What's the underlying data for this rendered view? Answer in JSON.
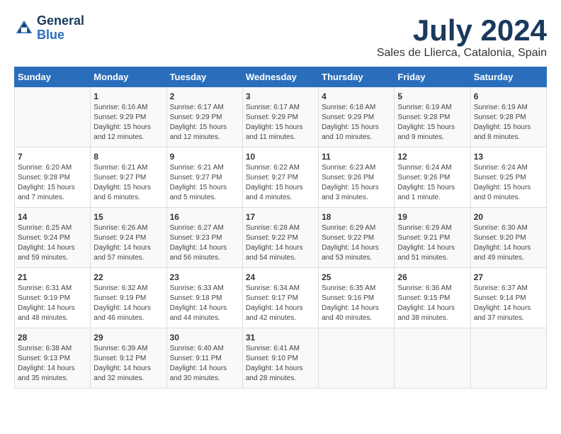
{
  "logo": {
    "line1": "General",
    "line2": "Blue"
  },
  "title": "July 2024",
  "location": "Sales de Llierca, Catalonia, Spain",
  "days_of_week": [
    "Sunday",
    "Monday",
    "Tuesday",
    "Wednesday",
    "Thursday",
    "Friday",
    "Saturday"
  ],
  "weeks": [
    [
      {
        "day": "",
        "sunrise": "",
        "sunset": "",
        "daylight": ""
      },
      {
        "day": "1",
        "sunrise": "Sunrise: 6:16 AM",
        "sunset": "Sunset: 9:29 PM",
        "daylight": "Daylight: 15 hours and 12 minutes."
      },
      {
        "day": "2",
        "sunrise": "Sunrise: 6:17 AM",
        "sunset": "Sunset: 9:29 PM",
        "daylight": "Daylight: 15 hours and 12 minutes."
      },
      {
        "day": "3",
        "sunrise": "Sunrise: 6:17 AM",
        "sunset": "Sunset: 9:29 PM",
        "daylight": "Daylight: 15 hours and 11 minutes."
      },
      {
        "day": "4",
        "sunrise": "Sunrise: 6:18 AM",
        "sunset": "Sunset: 9:29 PM",
        "daylight": "Daylight: 15 hours and 10 minutes."
      },
      {
        "day": "5",
        "sunrise": "Sunrise: 6:19 AM",
        "sunset": "Sunset: 9:28 PM",
        "daylight": "Daylight: 15 hours and 9 minutes."
      },
      {
        "day": "6",
        "sunrise": "Sunrise: 6:19 AM",
        "sunset": "Sunset: 9:28 PM",
        "daylight": "Daylight: 15 hours and 8 minutes."
      }
    ],
    [
      {
        "day": "7",
        "sunrise": "Sunrise: 6:20 AM",
        "sunset": "Sunset: 9:28 PM",
        "daylight": "Daylight: 15 hours and 7 minutes."
      },
      {
        "day": "8",
        "sunrise": "Sunrise: 6:21 AM",
        "sunset": "Sunset: 9:27 PM",
        "daylight": "Daylight: 15 hours and 6 minutes."
      },
      {
        "day": "9",
        "sunrise": "Sunrise: 6:21 AM",
        "sunset": "Sunset: 9:27 PM",
        "daylight": "Daylight: 15 hours and 5 minutes."
      },
      {
        "day": "10",
        "sunrise": "Sunrise: 6:22 AM",
        "sunset": "Sunset: 9:27 PM",
        "daylight": "Daylight: 15 hours and 4 minutes."
      },
      {
        "day": "11",
        "sunrise": "Sunrise: 6:23 AM",
        "sunset": "Sunset: 9:26 PM",
        "daylight": "Daylight: 15 hours and 3 minutes."
      },
      {
        "day": "12",
        "sunrise": "Sunrise: 6:24 AM",
        "sunset": "Sunset: 9:26 PM",
        "daylight": "Daylight: 15 hours and 1 minute."
      },
      {
        "day": "13",
        "sunrise": "Sunrise: 6:24 AM",
        "sunset": "Sunset: 9:25 PM",
        "daylight": "Daylight: 15 hours and 0 minutes."
      }
    ],
    [
      {
        "day": "14",
        "sunrise": "Sunrise: 6:25 AM",
        "sunset": "Sunset: 9:24 PM",
        "daylight": "Daylight: 14 hours and 59 minutes."
      },
      {
        "day": "15",
        "sunrise": "Sunrise: 6:26 AM",
        "sunset": "Sunset: 9:24 PM",
        "daylight": "Daylight: 14 hours and 57 minutes."
      },
      {
        "day": "16",
        "sunrise": "Sunrise: 6:27 AM",
        "sunset": "Sunset: 9:23 PM",
        "daylight": "Daylight: 14 hours and 56 minutes."
      },
      {
        "day": "17",
        "sunrise": "Sunrise: 6:28 AM",
        "sunset": "Sunset: 9:22 PM",
        "daylight": "Daylight: 14 hours and 54 minutes."
      },
      {
        "day": "18",
        "sunrise": "Sunrise: 6:29 AM",
        "sunset": "Sunset: 9:22 PM",
        "daylight": "Daylight: 14 hours and 53 minutes."
      },
      {
        "day": "19",
        "sunrise": "Sunrise: 6:29 AM",
        "sunset": "Sunset: 9:21 PM",
        "daylight": "Daylight: 14 hours and 51 minutes."
      },
      {
        "day": "20",
        "sunrise": "Sunrise: 6:30 AM",
        "sunset": "Sunset: 9:20 PM",
        "daylight": "Daylight: 14 hours and 49 minutes."
      }
    ],
    [
      {
        "day": "21",
        "sunrise": "Sunrise: 6:31 AM",
        "sunset": "Sunset: 9:19 PM",
        "daylight": "Daylight: 14 hours and 48 minutes."
      },
      {
        "day": "22",
        "sunrise": "Sunrise: 6:32 AM",
        "sunset": "Sunset: 9:19 PM",
        "daylight": "Daylight: 14 hours and 46 minutes."
      },
      {
        "day": "23",
        "sunrise": "Sunrise: 6:33 AM",
        "sunset": "Sunset: 9:18 PM",
        "daylight": "Daylight: 14 hours and 44 minutes."
      },
      {
        "day": "24",
        "sunrise": "Sunrise: 6:34 AM",
        "sunset": "Sunset: 9:17 PM",
        "daylight": "Daylight: 14 hours and 42 minutes."
      },
      {
        "day": "25",
        "sunrise": "Sunrise: 6:35 AM",
        "sunset": "Sunset: 9:16 PM",
        "daylight": "Daylight: 14 hours and 40 minutes."
      },
      {
        "day": "26",
        "sunrise": "Sunrise: 6:36 AM",
        "sunset": "Sunset: 9:15 PM",
        "daylight": "Daylight: 14 hours and 38 minutes."
      },
      {
        "day": "27",
        "sunrise": "Sunrise: 6:37 AM",
        "sunset": "Sunset: 9:14 PM",
        "daylight": "Daylight: 14 hours and 37 minutes."
      }
    ],
    [
      {
        "day": "28",
        "sunrise": "Sunrise: 6:38 AM",
        "sunset": "Sunset: 9:13 PM",
        "daylight": "Daylight: 14 hours and 35 minutes."
      },
      {
        "day": "29",
        "sunrise": "Sunrise: 6:39 AM",
        "sunset": "Sunset: 9:12 PM",
        "daylight": "Daylight: 14 hours and 32 minutes."
      },
      {
        "day": "30",
        "sunrise": "Sunrise: 6:40 AM",
        "sunset": "Sunset: 9:11 PM",
        "daylight": "Daylight: 14 hours and 30 minutes."
      },
      {
        "day": "31",
        "sunrise": "Sunrise: 6:41 AM",
        "sunset": "Sunset: 9:10 PM",
        "daylight": "Daylight: 14 hours and 28 minutes."
      },
      {
        "day": "",
        "sunrise": "",
        "sunset": "",
        "daylight": ""
      },
      {
        "day": "",
        "sunrise": "",
        "sunset": "",
        "daylight": ""
      },
      {
        "day": "",
        "sunrise": "",
        "sunset": "",
        "daylight": ""
      }
    ]
  ]
}
